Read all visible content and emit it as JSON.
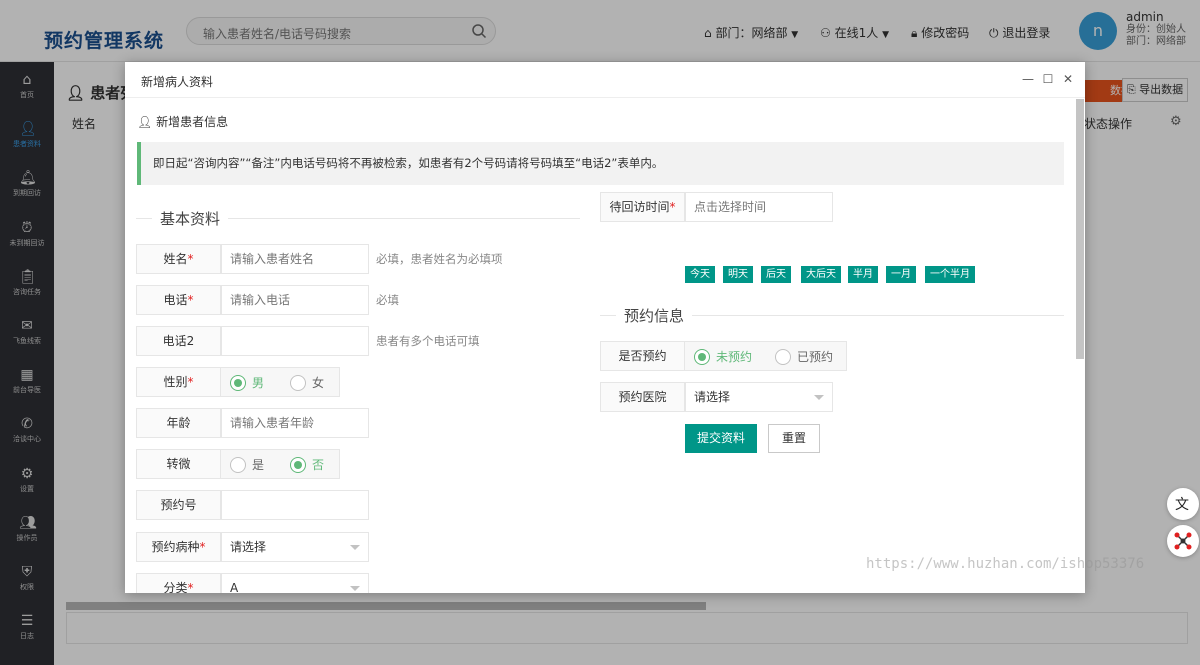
{
  "app": {
    "title": "预约管理系统"
  },
  "search": {
    "placeholder": "输入患者姓名/电话号码搜索"
  },
  "topbar": {
    "dept": "部门：网络部",
    "online": "在线1人",
    "change_pwd": "修改密码",
    "logout": "退出登录"
  },
  "user": {
    "avatar_letter": "n",
    "name": "admin",
    "role": "身份：创始人",
    "dept": "部门：网络部"
  },
  "sidebar": {
    "items": [
      {
        "label": "首页",
        "icon": "home-icon"
      },
      {
        "label": "患者资料",
        "icon": "patient-icon",
        "active": true
      },
      {
        "label": "到期回访",
        "icon": "bell-icon"
      },
      {
        "label": "未到期回访",
        "icon": "clock-icon"
      },
      {
        "label": "咨询任务",
        "icon": "clipboard-icon"
      },
      {
        "label": "飞鱼线索",
        "icon": "fish-icon"
      },
      {
        "label": "前台导医",
        "icon": "reception-icon"
      },
      {
        "label": "洽谈中心",
        "icon": "chat-icon"
      },
      {
        "label": "设置",
        "icon": "gear-icon"
      },
      {
        "label": "操作员",
        "icon": "operator-icon"
      },
      {
        "label": "权限",
        "icon": "shield-icon"
      },
      {
        "label": "日志",
        "icon": "log-icon"
      }
    ]
  },
  "page": {
    "title": "患者列",
    "col_name": "姓名",
    "col_status": "状态",
    "col_ops": "操作",
    "btn_data": "数据",
    "btn_export": "导出数据"
  },
  "modal": {
    "title": "新增病人资料",
    "section": "新增患者信息",
    "notice": "即日起“咨询内容”“备注”内电话号码将不再被检索，如患者有2个号码请将号码填至“电话2”表单内。",
    "basic_legend": "基本资料",
    "appt_legend": "预约信息",
    "fields": {
      "name": {
        "label": "姓名",
        "placeholder": "请输入患者姓名",
        "hint": "必填，患者姓名为必填项"
      },
      "phone": {
        "label": "电话",
        "placeholder": "请输入电话",
        "hint": "必填"
      },
      "phone2": {
        "label": "电话2",
        "placeholder": "",
        "hint": "患者有多个电话可填"
      },
      "gender": {
        "label": "性别",
        "options": [
          "男",
          "女"
        ],
        "selected": "男"
      },
      "age": {
        "label": "年龄",
        "placeholder": "请输入患者年龄"
      },
      "wechat": {
        "label": "转微",
        "options": [
          "是",
          "否"
        ],
        "selected": "否"
      },
      "appt_no": {
        "label": "预约号",
        "placeholder": ""
      },
      "disease": {
        "label": "预约病种",
        "value": "请选择"
      },
      "category": {
        "label": "分类",
        "value": "A"
      },
      "revisit": {
        "label": "待回访时间",
        "placeholder": "点击选择时间"
      },
      "booked": {
        "label": "是否预约",
        "options": [
          "未预约",
          "已预约"
        ],
        "selected": "未预约"
      },
      "hospital": {
        "label": "预约医院",
        "value": "请选择"
      }
    },
    "quick_dates": [
      "今天",
      "明天",
      "后天",
      "大后天",
      "半月",
      "一月",
      "一个半月"
    ],
    "submit": "提交资料",
    "reset": "重置"
  },
  "watermark": "https://www.huzhan.com/ishop53376"
}
